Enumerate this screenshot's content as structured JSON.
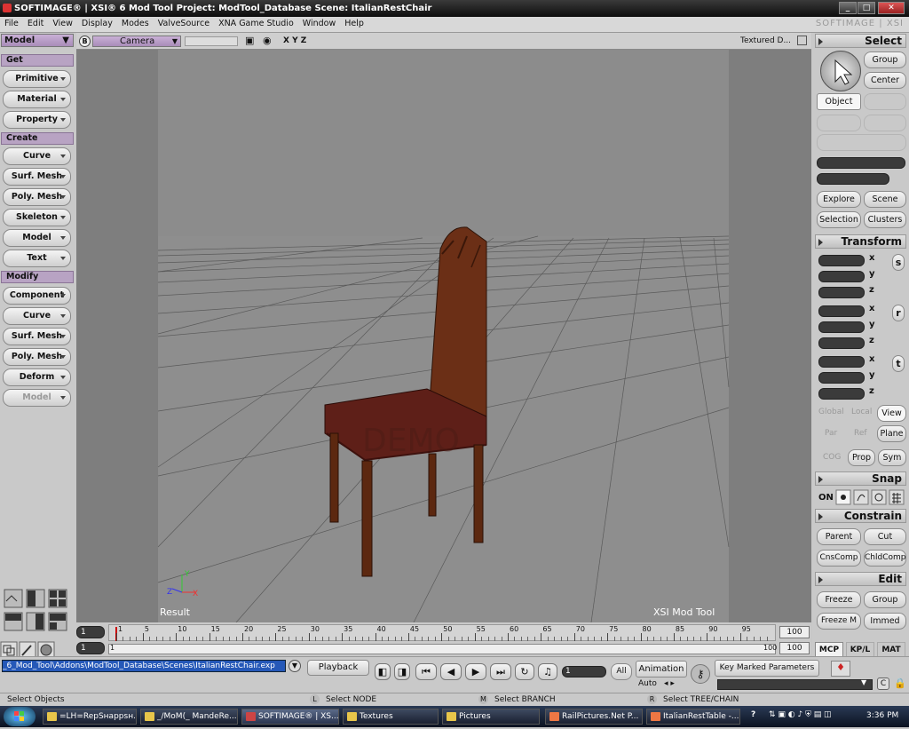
{
  "window": {
    "title": "SOFTIMAGE® | XSI® 6 Mod Tool Project: ModTool_Database    Scene: ItalianRestChair",
    "brand": "SOFTIMAGE | XSI",
    "controls": [
      "_",
      "□",
      "✕"
    ]
  },
  "menu": [
    "File",
    "Edit",
    "View",
    "Display",
    "Modes",
    "ValveSource",
    "XNA Game Studio",
    "Window",
    "Help"
  ],
  "left": {
    "mode": "Model",
    "sections": [
      {
        "title": "Get",
        "items": [
          "Primitive",
          "Material",
          "Property"
        ]
      },
      {
        "title": "Create",
        "items": [
          "Curve",
          "Surf. Mesh",
          "Poly. Mesh",
          "Skeleton",
          "Model",
          "Text"
        ]
      },
      {
        "title": "Modify",
        "items": [
          "Component",
          "Curve",
          "Surf. Mesh",
          "Poly. Mesh",
          "Deform",
          "Model"
        ]
      }
    ]
  },
  "viewport": {
    "b_label": "B",
    "camera": "Camera",
    "axes": "X Y Z",
    "shading": "Textured D...",
    "result": "Result",
    "watermark": "XSI Mod Tool",
    "demo": "DEMO",
    "axis_x": "X",
    "axis_y": "Y",
    "axis_z": "Z"
  },
  "right": {
    "select": "Select",
    "group": "Group",
    "center": "Center",
    "object": "Object",
    "explore": "Explore",
    "scene": "Scene",
    "selection": "Selection",
    "clusters": "Clusters",
    "transform": "Transform",
    "xyz": [
      "x",
      "y",
      "z"
    ],
    "srt": [
      "s",
      "r",
      "t"
    ],
    "global": "Global",
    "local": "Local",
    "view": "View",
    "par": "Par",
    "ref": "Ref",
    "plane": "Plane",
    "cog": "COG",
    "prop": "Prop",
    "sym": "Sym",
    "snap": "Snap",
    "on": "ON",
    "constrain": "Constrain",
    "parent": "Parent",
    "cut": "Cut",
    "cnscomp": "CnsComp",
    "chldcomp": "ChldComp",
    "edit": "Edit",
    "freeze": "Freeze",
    "group2": "Group",
    "freezem": "Freeze M",
    "immed": "Immed",
    "tabs": [
      "MCP",
      "KP/L",
      "MAT"
    ]
  },
  "timeline": {
    "start": "1",
    "end": "100",
    "start2": "1",
    "end2": "100",
    "current": "1",
    "ticks": [
      "1",
      "5",
      "10",
      "15",
      "20",
      "25",
      "30",
      "35",
      "40",
      "45",
      "50",
      "55",
      "60",
      "65",
      "70",
      "75",
      "80",
      "85",
      "90",
      "95"
    ]
  },
  "bottom": {
    "path": "_6_Mod_Tool\\Addons\\ModTool_Database\\Scenes\\ItalianRestChair.exp",
    "playback": "Playback",
    "frame": "1",
    "all": "All",
    "animation": "Animation",
    "auto": "Auto",
    "keymarked": "Key Marked Parameters"
  },
  "status": {
    "left": "Select Objects",
    "l_key": "L",
    "l_text": "Select NODE",
    "m_key": "M",
    "m_text": "Select BRANCH",
    "r_key": "R",
    "r_text": "Select TREE/CHAIN"
  },
  "taskbar": {
    "items": [
      "=LH=RepSнарpsн...",
      "_/MoM(_ MandeRe...",
      "SOFTIMAGE® | XS...",
      "Textures",
      "Pictures",
      "RailPictures.Net P...",
      "ItalianRestTable -..."
    ],
    "clock": "3:36 PM",
    "help": "?"
  }
}
